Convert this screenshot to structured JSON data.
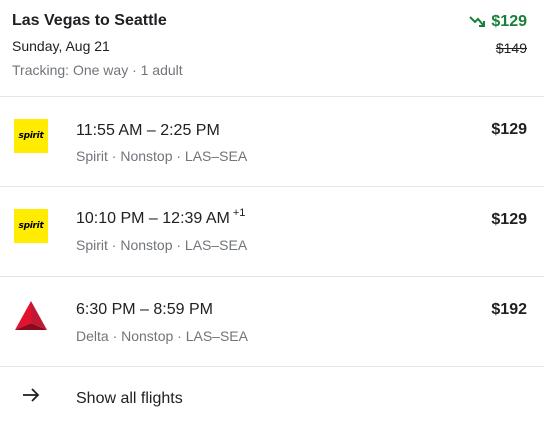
{
  "header": {
    "title": "Las Vegas to Seattle",
    "date": "Sunday, Aug 21",
    "tracking": "Tracking: One way · 1 adult",
    "current_price": "$129",
    "previous_price": "$149",
    "trend_icon": "trending-down-icon",
    "price_color": "#188038"
  },
  "flights": [
    {
      "airline_logo": "spirit-logo",
      "logo_text": "spirit",
      "times": "11:55 AM – 2:25 PM",
      "day_offset": "",
      "details": "Spirit · Nonstop · LAS–SEA",
      "price": "$129"
    },
    {
      "airline_logo": "spirit-logo",
      "logo_text": "spirit",
      "times": "10:10 PM – 12:39 AM",
      "day_offset": "+1",
      "details": "Spirit · Nonstop · LAS–SEA",
      "price": "$129"
    },
    {
      "airline_logo": "delta-logo",
      "logo_text": "",
      "times": "6:30 PM – 8:59 PM",
      "day_offset": "",
      "details": "Delta · Nonstop · LAS–SEA",
      "price": "$192"
    }
  ],
  "footer": {
    "show_all_label": "Show all flights",
    "icon": "arrow-right-icon"
  }
}
